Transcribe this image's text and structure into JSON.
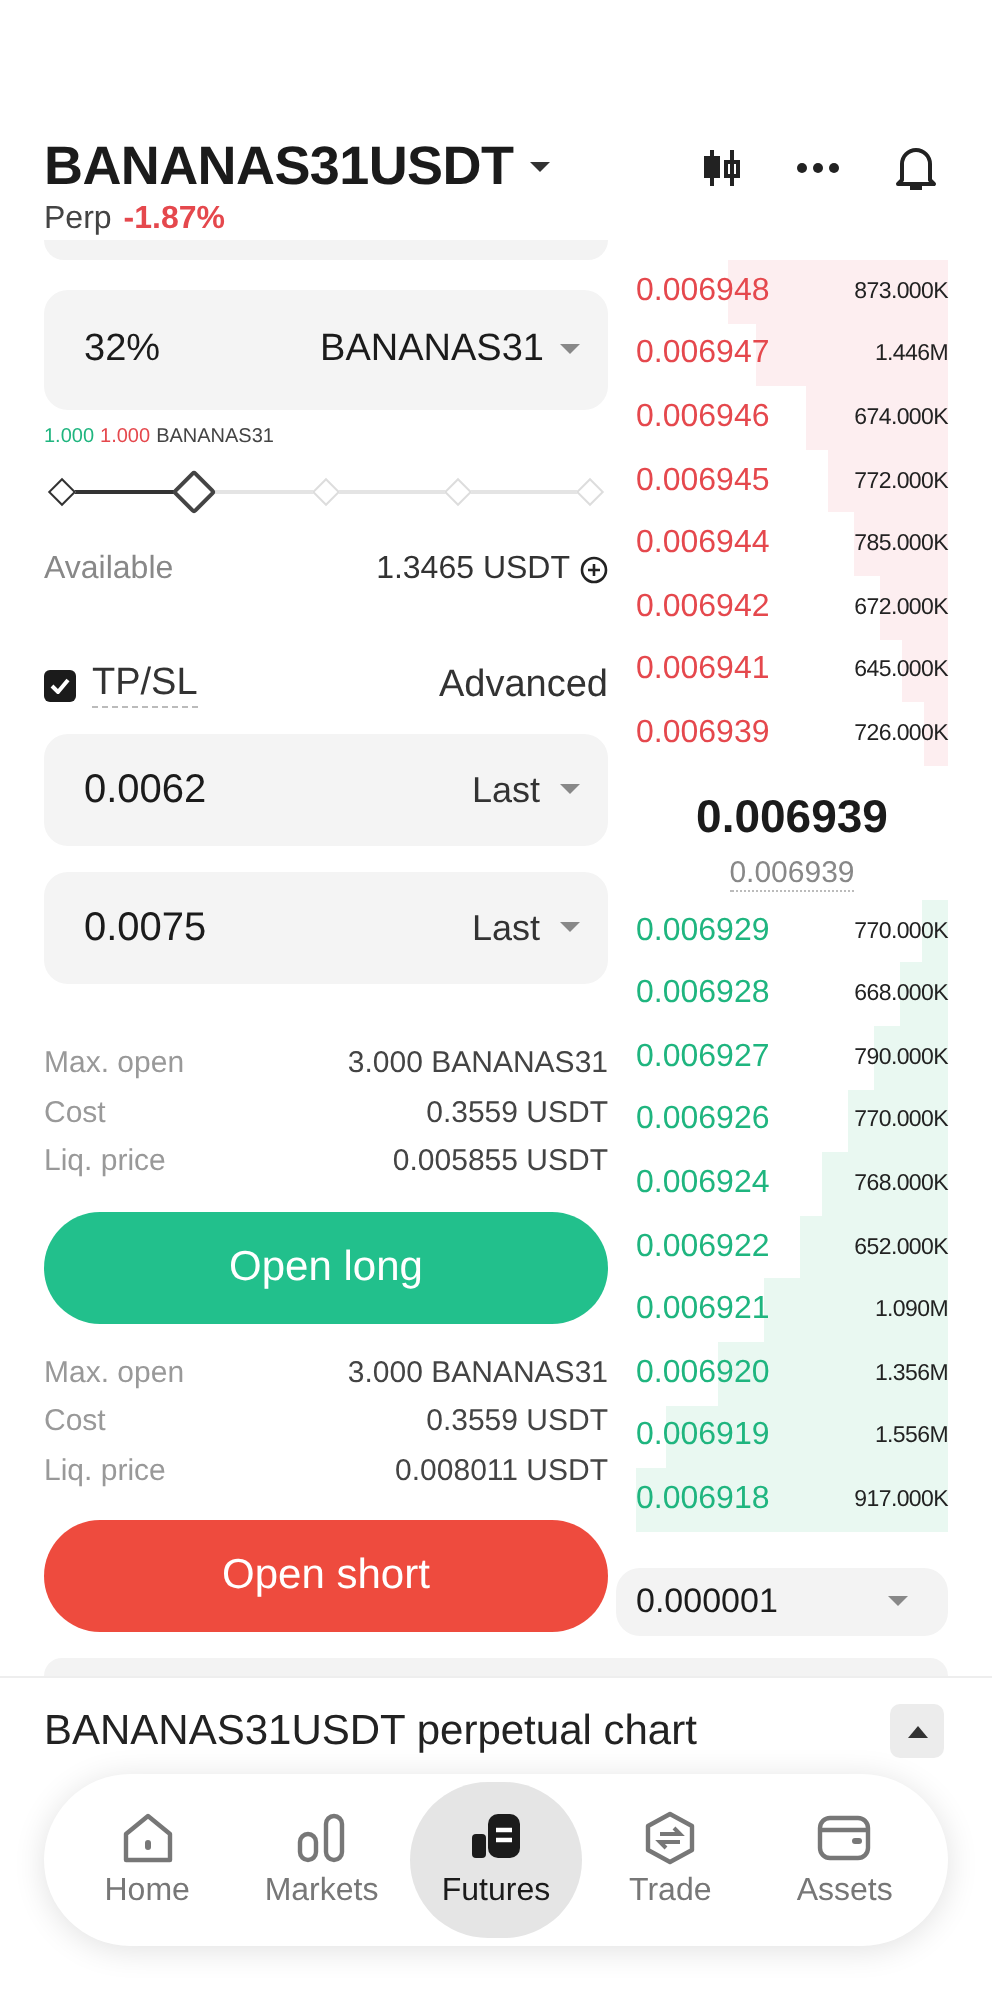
{
  "header": {
    "symbol": "BANANAS31USDT",
    "contract": "Perp",
    "change": "-1.87%"
  },
  "form": {
    "amount": "32%",
    "unit": "BANANAS31",
    "ratio": {
      "long": "1.000",
      "short": "1.000",
      "unit": "BANANAS31"
    },
    "slider": {
      "level": 0.25
    },
    "available": {
      "label": "Available",
      "value": "1.3465 USDT"
    },
    "tpsl": {
      "label": "TP/SL",
      "checked": true,
      "advanced": "Advanced"
    },
    "triggers": [
      {
        "value": "0.0062",
        "type": "Last"
      },
      {
        "value": "0.0075",
        "type": "Last"
      }
    ],
    "long": {
      "info": [
        {
          "label": "Max. open",
          "value": "3.000 BANANAS31"
        },
        {
          "label": "Cost",
          "value": "0.3559 USDT"
        },
        {
          "label": "Liq. price",
          "value": "0.005855 USDT"
        }
      ],
      "button": "Open long"
    },
    "short": {
      "info": [
        {
          "label": "Max. open",
          "value": "3.000 BANANAS31"
        },
        {
          "label": "Cost",
          "value": "0.3559 USDT"
        },
        {
          "label": "Liq. price",
          "value": "0.008011 USDT"
        }
      ],
      "button": "Open short"
    }
  },
  "order_book": {
    "asks": [
      {
        "price": "0.006948",
        "amount": "873.000K"
      },
      {
        "price": "0.006947",
        "amount": "1.446M"
      },
      {
        "price": "0.006946",
        "amount": "674.000K"
      },
      {
        "price": "0.006945",
        "amount": "772.000K"
      },
      {
        "price": "0.006944",
        "amount": "785.000K"
      },
      {
        "price": "0.006942",
        "amount": "672.000K"
      },
      {
        "price": "0.006941",
        "amount": "645.000K"
      },
      {
        "price": "0.006939",
        "amount": "726.000K"
      }
    ],
    "last_price": "0.006939",
    "mark_price": "0.006939",
    "bids": [
      {
        "price": "0.006929",
        "amount": "770.000K"
      },
      {
        "price": "0.006928",
        "amount": "668.000K"
      },
      {
        "price": "0.006927",
        "amount": "790.000K"
      },
      {
        "price": "0.006926",
        "amount": "770.000K"
      },
      {
        "price": "0.006924",
        "amount": "768.000K"
      },
      {
        "price": "0.006922",
        "amount": "652.000K"
      },
      {
        "price": "0.006921",
        "amount": "1.090M"
      },
      {
        "price": "0.006920",
        "amount": "1.356M"
      },
      {
        "price": "0.006919",
        "amount": "1.556M"
      },
      {
        "price": "0.006918",
        "amount": "917.000K"
      }
    ],
    "precision": "0.000001"
  },
  "chart_bar": {
    "title": "BANANAS31USDT perpetual chart",
    "expanded": false
  },
  "nav": [
    {
      "label": "Home",
      "selected": false
    },
    {
      "label": "Markets",
      "selected": false
    },
    {
      "label": "Futures",
      "selected": true
    },
    {
      "label": "Trade",
      "selected": false
    },
    {
      "label": "Assets",
      "selected": false
    }
  ]
}
